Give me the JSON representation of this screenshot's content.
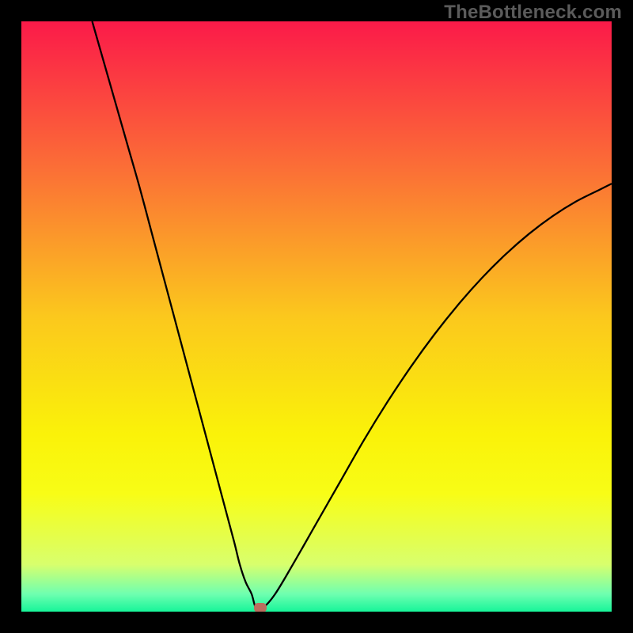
{
  "watermark": "TheBottleneck.com",
  "chart_data": {
    "type": "line",
    "title": "",
    "xlabel": "",
    "ylabel": "",
    "xlim": [
      0,
      100
    ],
    "ylim": [
      0,
      100
    ],
    "grid": false,
    "gradient_background": {
      "stops": [
        {
          "offset": 0.0,
          "color": "#fb1a49"
        },
        {
          "offset": 0.25,
          "color": "#fb6f36"
        },
        {
          "offset": 0.5,
          "color": "#fbc81d"
        },
        {
          "offset": 0.7,
          "color": "#faf209"
        },
        {
          "offset": 0.8,
          "color": "#f8fd16"
        },
        {
          "offset": 0.92,
          "color": "#d8ff6d"
        },
        {
          "offset": 0.97,
          "color": "#6fffb0"
        },
        {
          "offset": 1.0,
          "color": "#17f59a"
        }
      ]
    },
    "series": [
      {
        "name": "curve",
        "color": "#000000",
        "width": 2.3,
        "x": [
          12,
          14,
          16,
          18,
          20,
          22,
          24,
          26,
          28,
          30,
          32,
          34,
          36,
          37,
          38,
          39,
          39.8,
          41,
          43,
          46,
          50,
          54,
          58,
          62,
          66,
          70,
          74,
          78,
          82,
          86,
          90,
          94,
          98,
          100
        ],
        "y": [
          100,
          93,
          86,
          79,
          72,
          64.5,
          57,
          49.5,
          42,
          34.5,
          27,
          19.5,
          12,
          8,
          5,
          3,
          0.5,
          0.7,
          3,
          8,
          15,
          22,
          29,
          35.5,
          41.5,
          47,
          52,
          56.5,
          60.5,
          64,
          67,
          69.5,
          71.5,
          72.5
        ]
      }
    ],
    "marker": {
      "x": 40.5,
      "y": 0.7,
      "color": "#bb6e5e"
    }
  }
}
